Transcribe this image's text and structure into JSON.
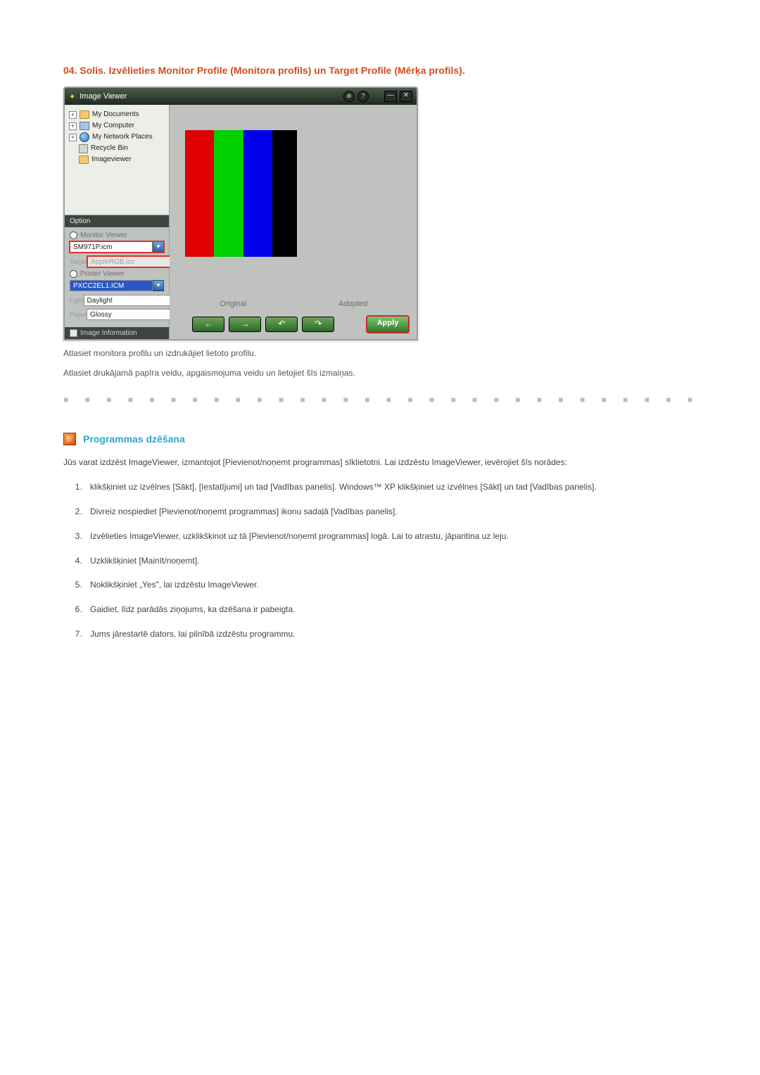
{
  "step": {
    "title": "04. Solis. Izvēlieties Monitor Profile (Monitora profils) un Target Profile (Mērķa profils)."
  },
  "iv": {
    "title": "Image Viewer",
    "tree": {
      "items": [
        "My Documents",
        "My Computer",
        "My Network Places",
        "Recycle Bin",
        "Imageviewer"
      ]
    },
    "option": {
      "header": "Option",
      "monitor_label": "Monitor Viewer",
      "monitor_value": "SM971P.icm",
      "target_label": "Target",
      "target_value": "AppleRGB.icc",
      "printer_label": "Printer Viewer",
      "printer_value": "PXCC2EL1.ICM",
      "light_label": "Light",
      "light_value": "Daylight",
      "paper_label": "Paper",
      "paper_value": "Glossy",
      "footer": "Image Information"
    },
    "preview": {
      "original": "Original",
      "adopted": "Adopted"
    },
    "buttons": {
      "back": "←",
      "forward": "→",
      "undo": "↶",
      "redo": "↷",
      "apply": "Apply"
    },
    "titlebar": {
      "min": "—",
      "close": "✕",
      "info1": "⊕",
      "info2": "?"
    }
  },
  "caption": {
    "line1": "Atlasiet monitora profilu un izdrukājiet lietoto profilu.",
    "line2": "Atlasiet drukājamā papīra veidu, apgaismojuma veidu un lietojiet šīs izmaiņas."
  },
  "section": {
    "title": "Programmas dzēšana",
    "intro": "Jūs varat izdzēst ImageViewer, izmantojot [Pievienot/noņemt programmas] sīklietotni. Lai izdzēstu ImageViewer, ievērojiet šīs norādes:",
    "steps": [
      "klikšķiniet uz izvēlnes [Sākt], [Iestatījumi] un tad [Vadības panelis]. Windows™ XP klikšķiniet uz izvēlnes [Sākt] un tad [Vadības panelis].",
      "Divreiz nospiediet [Pievienot/noņemt programmas] ikonu sadaļā [Vadības panelis].",
      "Izvēlieties ImageViewer, uzklikšķinot uz tā [Pievienot/noņemt programmas] logā. Lai to atrastu, jāparitina uz leju.",
      "Uzklikšķiniet [Mainīt/noņemt].",
      "Noklikšķiniet „Yes\", lai izdzēstu ImageViewer.",
      "Gaidiet, līdz parādās ziņojums, ka dzēšana ir pabeigta.",
      "Jums jārestartē dators, lai pilnībā izdzēstu programmu."
    ]
  },
  "dots": "■ ■ ■ ■ ■ ■ ■ ■ ■ ■ ■ ■ ■ ■ ■ ■ ■ ■ ■ ■ ■ ■ ■ ■ ■ ■ ■ ■ ■ ■ ■ ■ ■ ■ ■ ■ ■ ■ ■ ■ ■ ■ ■ ■ ■ ■"
}
